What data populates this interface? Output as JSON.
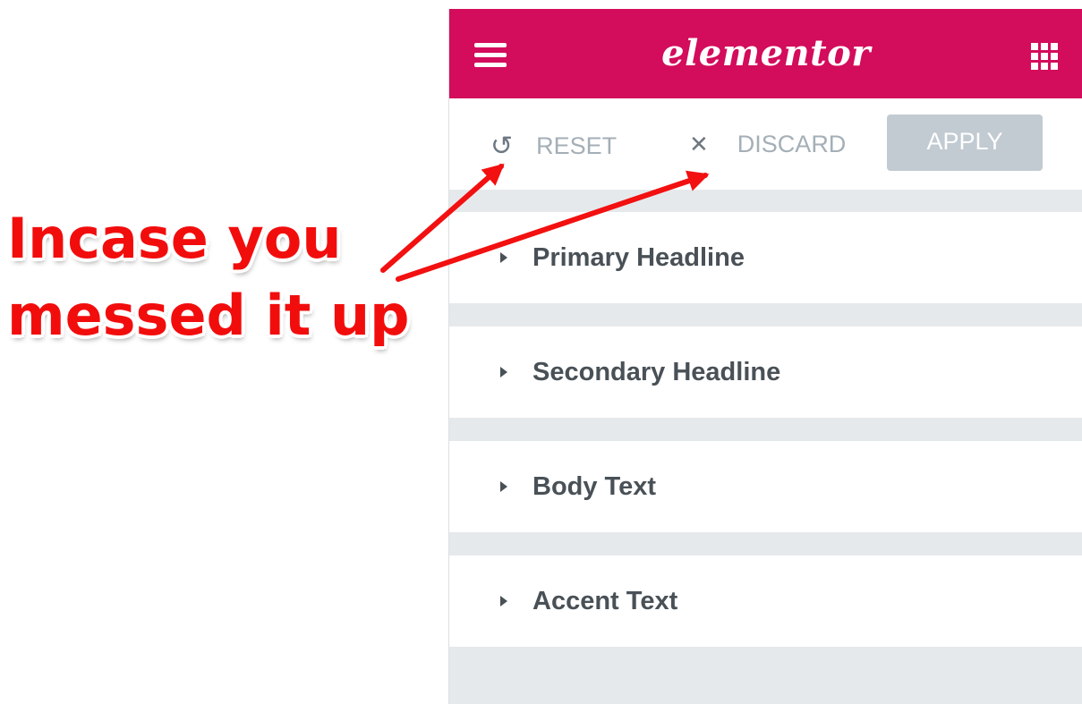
{
  "annotation": {
    "line1": "Incase you",
    "line2": "messed it up"
  },
  "topbar": {
    "logo": "elementor",
    "menu_icon": "hamburger-menu-icon",
    "apps_icon": "grid-apps-icon"
  },
  "actions": {
    "reset_label": "RESET",
    "reset_icon": "undo-icon",
    "discard_label": "DISCARD",
    "discard_icon": "close-icon",
    "apply_label": "APPLY"
  },
  "sections": [
    {
      "label": "Primary Headline"
    },
    {
      "label": "Secondary Headline"
    },
    {
      "label": "Body Text"
    },
    {
      "label": "Accent Text"
    }
  ],
  "colors": {
    "brand": "#d30c5c",
    "annotation": "#f20d0d",
    "panel_bg": "#e6e9ec",
    "apply_bg": "#c2cbd2"
  }
}
